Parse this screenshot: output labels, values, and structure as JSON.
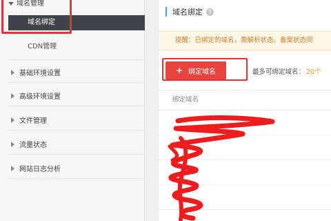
{
  "sidebar": {
    "top_label": "域名管理",
    "active_item": "域名绑定",
    "sub_item": "CDN管理",
    "groups": [
      "基础环境设置",
      "高级环境设置",
      "文件管理",
      "流量状态",
      "网站日志分析"
    ]
  },
  "main": {
    "title": "域名绑定",
    "help": "?",
    "notice": "提醒：已绑定的域名，需解析状态、备案状态同",
    "add_button": "绑定域名",
    "add_plus": "+",
    "limit_label": "最多可绑定域名：",
    "limit_value": "20个",
    "table_header": "绑定域名"
  },
  "colors": {
    "accent": "#3fa3d6",
    "button": "#e8433c",
    "annotation": "#e53333",
    "notice_text": "#d07a2a"
  }
}
